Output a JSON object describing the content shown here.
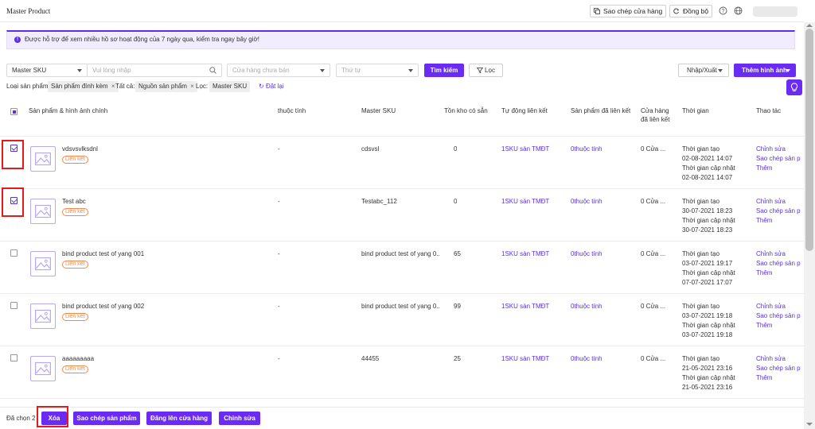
{
  "header": {
    "title": "Master Product",
    "copy_store_label": "Sao chép cửa hàng",
    "sync_label": "Đồng bộ"
  },
  "notice": {
    "text": "Được hỗ trợ để xem nhiều hồ sơ hoạt động của 7 ngày qua, kiểm tra ngay bây giờ!"
  },
  "filters": {
    "search_type": "Master SKU",
    "search_placeholder": "Vui lòng nhập",
    "store_placeholder": "Cửa hàng chưa bán",
    "order_placeholder": "Thứ tự",
    "search_button": "Tìm kiếm",
    "filter_button": "Lọc",
    "import_export": "Nhập/Xuất",
    "add_image": "Thêm hình ảnh"
  },
  "active_filters": {
    "type_label": "Loại sản phẩm:",
    "type_value": "Sản phẩm đính kèm",
    "all_label": "Tất cả:",
    "all_value": "Nguồn sản phẩm",
    "filter_label": "Lọc:",
    "filter_value": "Master SKU",
    "reset_label": "Đặt lại"
  },
  "table": {
    "columns": [
      "Sản phẩm & hình ảnh chính",
      "thuộc tính",
      "Master SKU",
      "Tồn kho có sẵn",
      "Tự động liên kết",
      "Sản phẩm đã liên kết",
      "Cửa hàng đã liên kết",
      "Thời gian",
      "Thao tác"
    ],
    "rows": [
      {
        "name": "vdsvsvlksdnl",
        "badge": "Liên kết",
        "attr": "-",
        "sku": "cdsvsl",
        "stock": "0",
        "auto": "1SKU sàn TMĐT",
        "linked": "0thuộc tính",
        "store": "0 Cửa ...",
        "created_label": "Thời gian tạo",
        "created": "02-08-2021 14:07",
        "updated_label": "Thời gian cập nhật",
        "updated": "02-08-2021 14:07",
        "act1": "Chỉnh sửa",
        "act2": "Sao chép sản p",
        "act3": "Thêm",
        "checked": true
      },
      {
        "name": "Test abc",
        "badge": "Liên kết",
        "attr": "-",
        "sku": "Testabc_112",
        "stock": "0",
        "auto": "1SKU sàn TMĐT",
        "linked": "0thuộc tính",
        "store": "0 Cửa ...",
        "created_label": "Thời gian tạo",
        "created": "30-07-2021 18:23",
        "updated_label": "Thời gian cập nhật",
        "updated": "30-07-2021 18:23",
        "act1": "Chỉnh sửa",
        "act2": "Sao chép sản p",
        "act3": "Thêm",
        "checked": true
      },
      {
        "name": "bind product test of yang 001",
        "badge": "Liên kết",
        "attr": "-",
        "sku": "bind product test of yang 0...",
        "stock": "65",
        "auto": "1SKU sàn TMĐT",
        "linked": "0thuộc tính",
        "store": "0 Cửa ...",
        "created_label": "Thời gian tạo",
        "created": "03-07-2021 19:17",
        "updated_label": "Thời gian cập nhật",
        "updated": "07-07-2021 17:07",
        "act1": "Chỉnh sửa",
        "act2": "Sao chép sản p",
        "act3": "Thêm",
        "checked": false
      },
      {
        "name": "bind product test of yang 002",
        "badge": "Liên kết",
        "attr": "-",
        "sku": "bind product test of yang 0...",
        "stock": "99",
        "auto": "1SKU sàn TMĐT",
        "linked": "0thuộc tính",
        "store": "0 Cửa ...",
        "created_label": "Thời gian tạo",
        "created": "03-07-2021 19:18",
        "updated_label": "Thời gian cập nhật",
        "updated": "03-07-2021 19:18",
        "act1": "Chỉnh sửa",
        "act2": "Sao chép sản p",
        "act3": "Thêm",
        "checked": false
      },
      {
        "name": "aaaaaaaaa",
        "badge": "Liên kết",
        "attr": "-",
        "sku": "44455",
        "stock": "25",
        "auto": "1SKU sàn TMĐT",
        "linked": "0thuộc tính",
        "store": "0 Cửa ...",
        "created_label": "Thời gian tạo",
        "created": "21-05-2021 23:16",
        "updated_label": "Thời gian cập nhật",
        "updated": "21-05-2021 23:16",
        "act1": "Chỉnh sửa",
        "act2": "Sao chép sản p",
        "act3": "Thêm",
        "checked": false
      }
    ]
  },
  "bottom": {
    "selected_label": "Đã chọn 2",
    "delete": "Xóa",
    "copy_product": "Sao chép sản phẩm",
    "publish": "Đăng lên cửa hàng",
    "edit": "Chỉnh sửa"
  },
  "colors": {
    "accent": "#6a2cf5",
    "badge": "#f08a4b",
    "highlight": "#e21b1b"
  }
}
